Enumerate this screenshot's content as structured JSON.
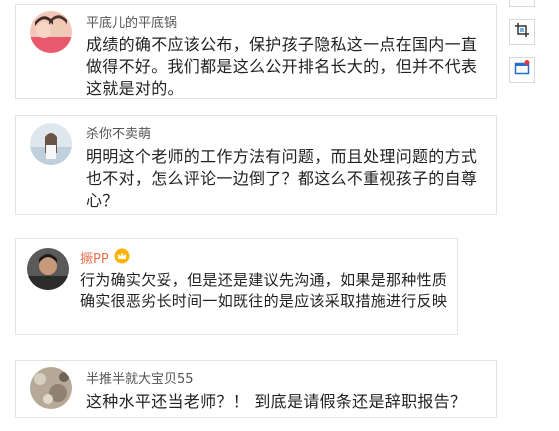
{
  "comments": [
    {
      "username": "平底儿的平底锅",
      "text": "成绩的确不应该公布，保护孩子隐私这一点在国内一直做得不好。我们都是这么公开排名长大的，但并不代表这就是对的。"
    },
    {
      "username": "杀你不卖萌",
      "text": "明明这个老师的工作方法有问题，而且处理问题的方式也不对，怎么评论一边倒了？都这么不重视孩子的自尊心？"
    },
    {
      "username": "撅PP",
      "text": "行为确实欠妥，但是还是建议先沟通，如果是那种性质确实很恶劣长时间一如既往的是应该采取措施进行反映"
    },
    {
      "username": "半推半就大宝贝55",
      "text": "这种水平还当老师？！ 到底是请假条还是辞职报告？"
    }
  ],
  "toolbar": {
    "icons": [
      "crop-icon",
      "window-icon"
    ]
  },
  "colors": {
    "username": "#555555",
    "username_highlight": "#eb7350",
    "border": "#e3e3e3"
  }
}
